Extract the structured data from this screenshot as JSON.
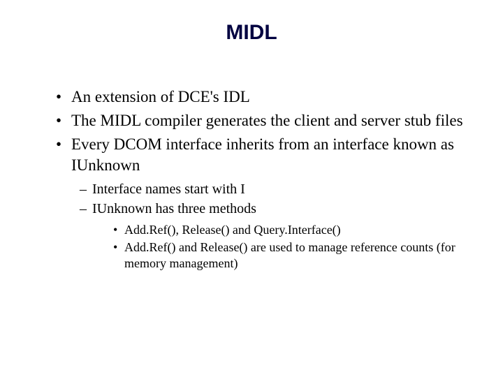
{
  "title": "MIDL",
  "bullets": [
    "An extension of DCE's IDL",
    "The MIDL compiler generates the client and server stub files",
    "Every DCOM interface inherits from an interface known as IUnknown"
  ],
  "sub_bullets": [
    "Interface names start with I",
    "IUnknown has three methods"
  ],
  "sub_sub_bullets": [
    "Add.Ref(), Release() and Query.Interface()",
    "Add.Ref() and Release() are used to manage reference counts (for memory management)"
  ]
}
